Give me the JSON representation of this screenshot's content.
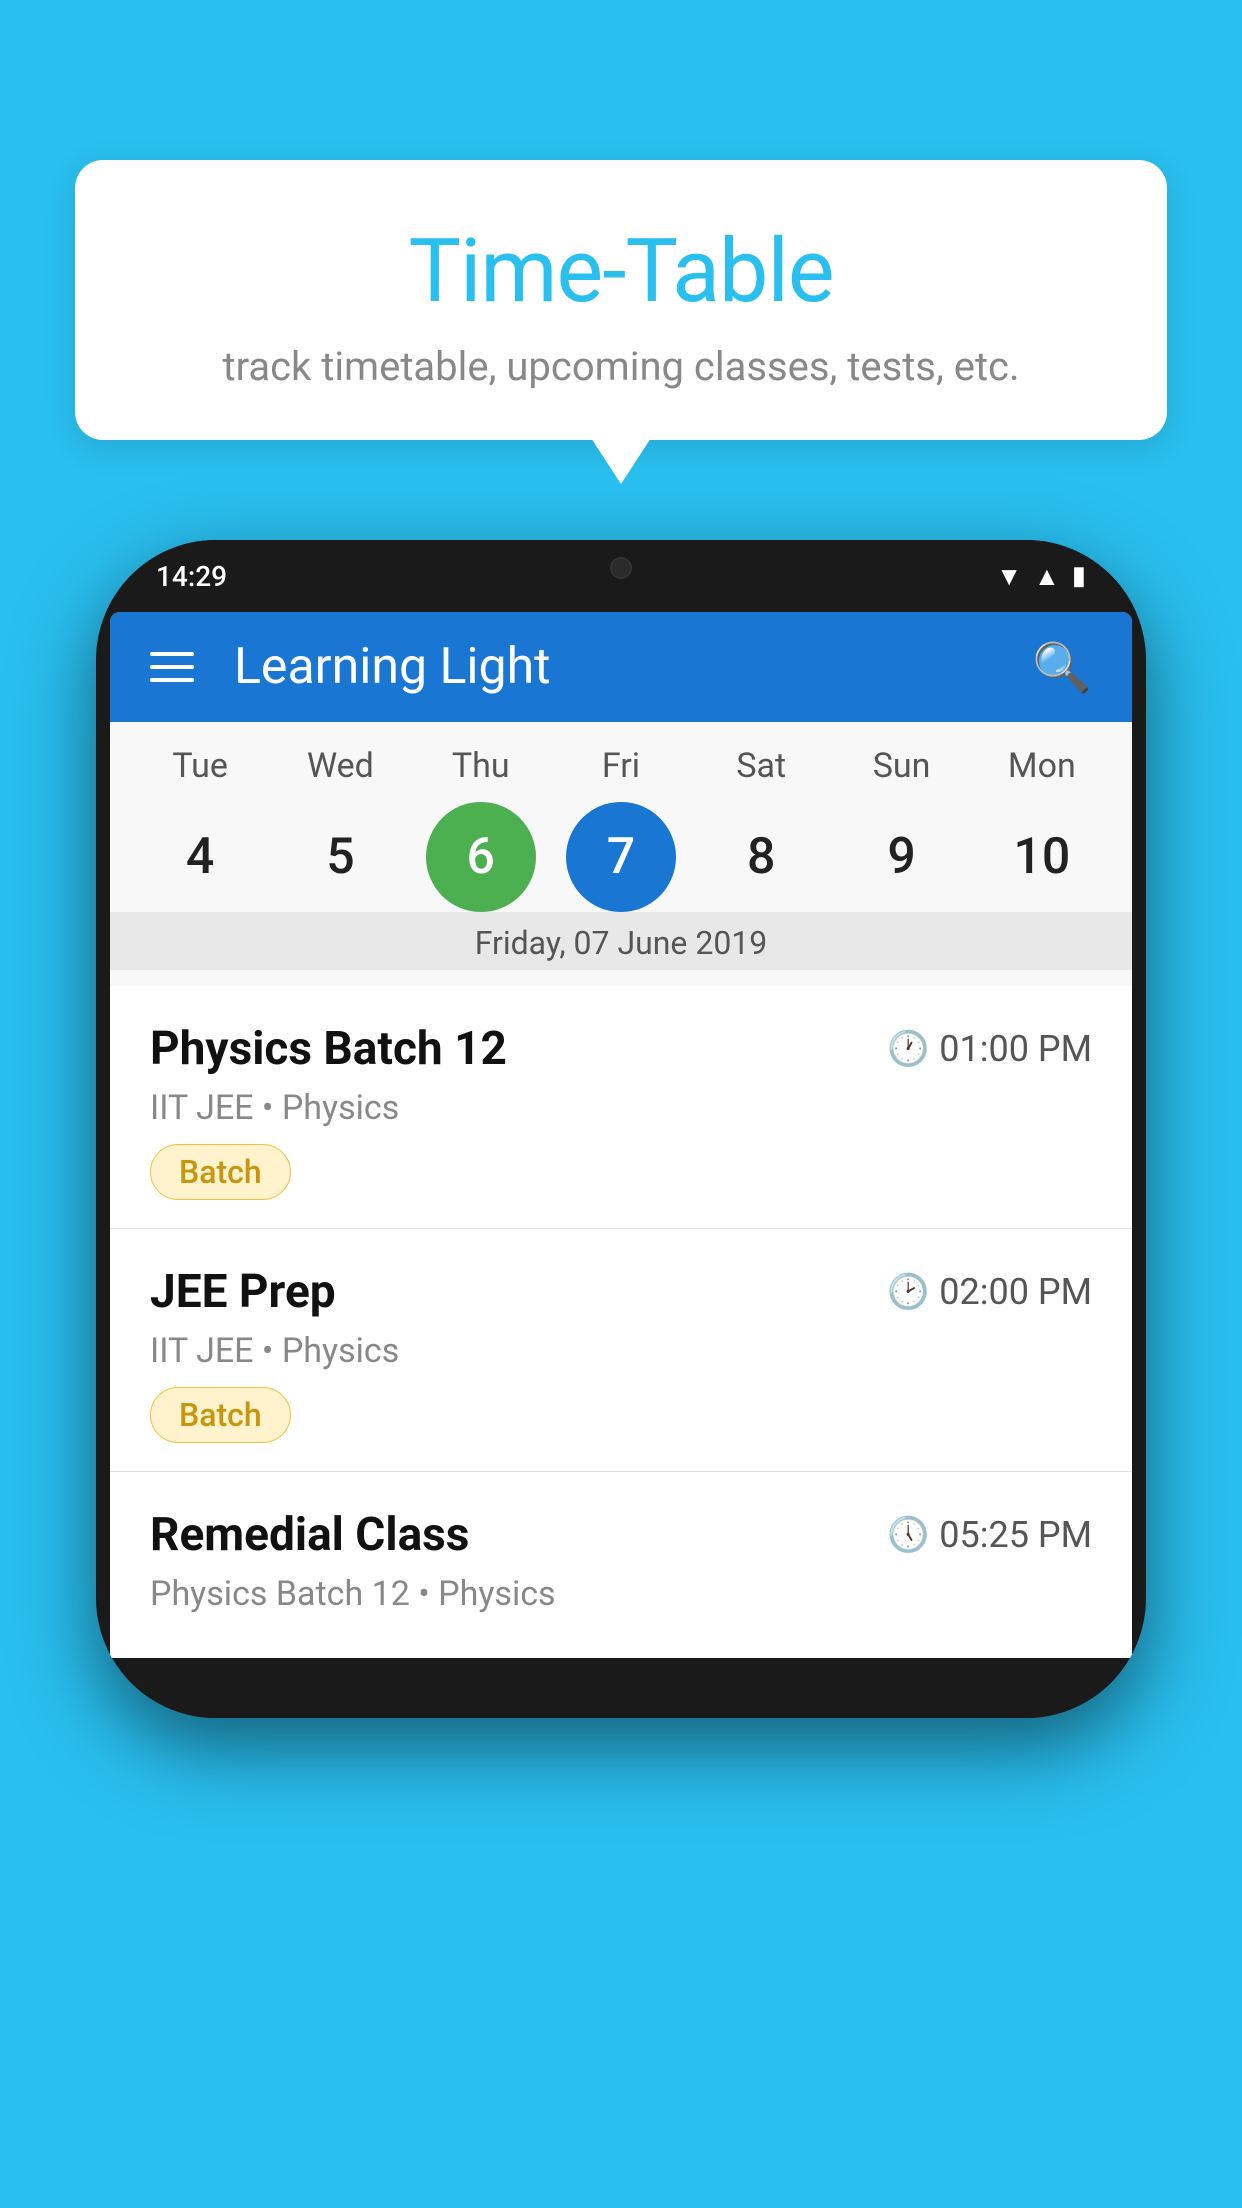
{
  "background_color": "#29BFEF",
  "tooltip": {
    "title": "Time-Table",
    "subtitle": "track timetable, upcoming classes, tests, etc."
  },
  "phone": {
    "status_bar": {
      "time": "14:29"
    },
    "app_bar": {
      "title": "Learning Light"
    },
    "calendar": {
      "days": [
        {
          "label": "Tue",
          "number": "4"
        },
        {
          "label": "Wed",
          "number": "5"
        },
        {
          "label": "Thu",
          "number": "6",
          "state": "today"
        },
        {
          "label": "Fri",
          "number": "7",
          "state": "selected"
        },
        {
          "label": "Sat",
          "number": "8"
        },
        {
          "label": "Sun",
          "number": "9"
        },
        {
          "label": "Mon",
          "number": "10"
        }
      ],
      "selected_date_label": "Friday, 07 June 2019"
    },
    "schedule": [
      {
        "title": "Physics Batch 12",
        "time": "01:00 PM",
        "subtitle": "IIT JEE • Physics",
        "tag": "Batch"
      },
      {
        "title": "JEE Prep",
        "time": "02:00 PM",
        "subtitle": "IIT JEE • Physics",
        "tag": "Batch"
      },
      {
        "title": "Remedial Class",
        "time": "05:25 PM",
        "subtitle": "Physics Batch 12 • Physics",
        "tag": ""
      }
    ]
  }
}
